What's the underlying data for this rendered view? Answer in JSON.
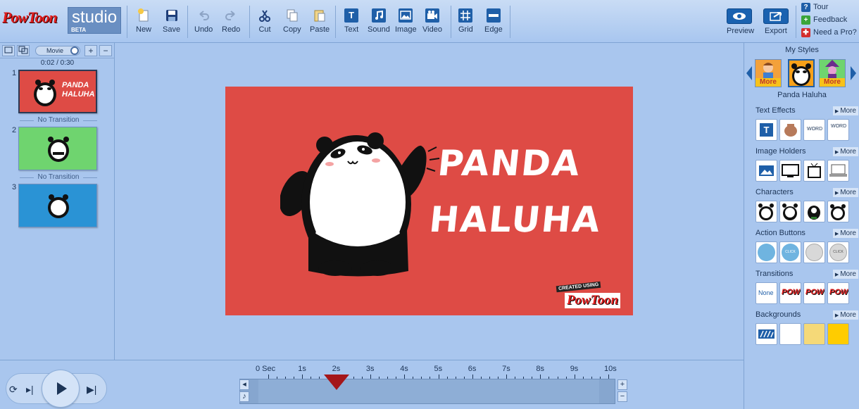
{
  "app": {
    "logo_text": "PowToon",
    "studio_label": "studio",
    "beta_label": "BETA"
  },
  "toolbar": {
    "new": "New",
    "save": "Save",
    "undo": "Undo",
    "redo": "Redo",
    "cut": "Cut",
    "copy": "Copy",
    "paste": "Paste",
    "text": "Text",
    "text_icon_glyph": "T",
    "sound": "Sound",
    "image": "Image",
    "video": "Video",
    "grid": "Grid",
    "edge": "Edge",
    "preview": "Preview",
    "export": "Export",
    "tour": "Tour",
    "feedback": "Feedback",
    "need_pro": "Need a Pro?"
  },
  "slides_panel": {
    "movie_label": "Movie",
    "add_glyph": "+",
    "remove_glyph": "−",
    "timecode": "0:02 / 0:30",
    "slides": [
      {
        "number": "1",
        "color": "#de4b45",
        "thumb_title_1": "PANDA",
        "thumb_title_2": "HALUHA"
      },
      {
        "number": "2",
        "color": "#6fd46f"
      },
      {
        "number": "3",
        "color": "#2a93d5"
      }
    ],
    "transitions": [
      "No Transition",
      "No Transition"
    ]
  },
  "slide": {
    "background": "#de4b45",
    "title_line1": "PANDA",
    "title_line2": "HALUHA",
    "badge_small": "CREATED USING",
    "badge_logo": "PowToon"
  },
  "styles_panel": {
    "title": "My Styles",
    "style_more_1": "More",
    "style_more_3": "More",
    "selected_style": "Panda Haluha",
    "sections": {
      "text_effects": "Text Effects",
      "image_holders": "Image Holders",
      "characters": "Characters",
      "action_buttons": "Action Buttons",
      "transitions": "Transitions",
      "backgrounds": "Backgrounds"
    },
    "more_label": "More",
    "text_tiles": [
      "T",
      "",
      "WORD",
      "WORD"
    ],
    "action_tiles": [
      "",
      "CLICK HERE",
      "",
      "CLICK HERE"
    ],
    "transition_tiles": [
      "None",
      "POW",
      "POW",
      "POW"
    ],
    "backgrounds": [
      "#ffffff",
      "#f5d978",
      "#ffcc00"
    ]
  },
  "timeline": {
    "labels": [
      "0 Sec",
      "1s",
      "2s",
      "3s",
      "4s",
      "5s",
      "6s",
      "7s",
      "8s",
      "9s",
      "10s"
    ],
    "current_seconds": 2,
    "up_glyph": "◂",
    "music_glyph": "♪",
    "plus_glyph": "+",
    "minus_glyph": "−"
  },
  "colors": {
    "accent_blue": "#1f5fa8",
    "scrubber": "#a4161a",
    "brand_red": "#e11d1d"
  }
}
